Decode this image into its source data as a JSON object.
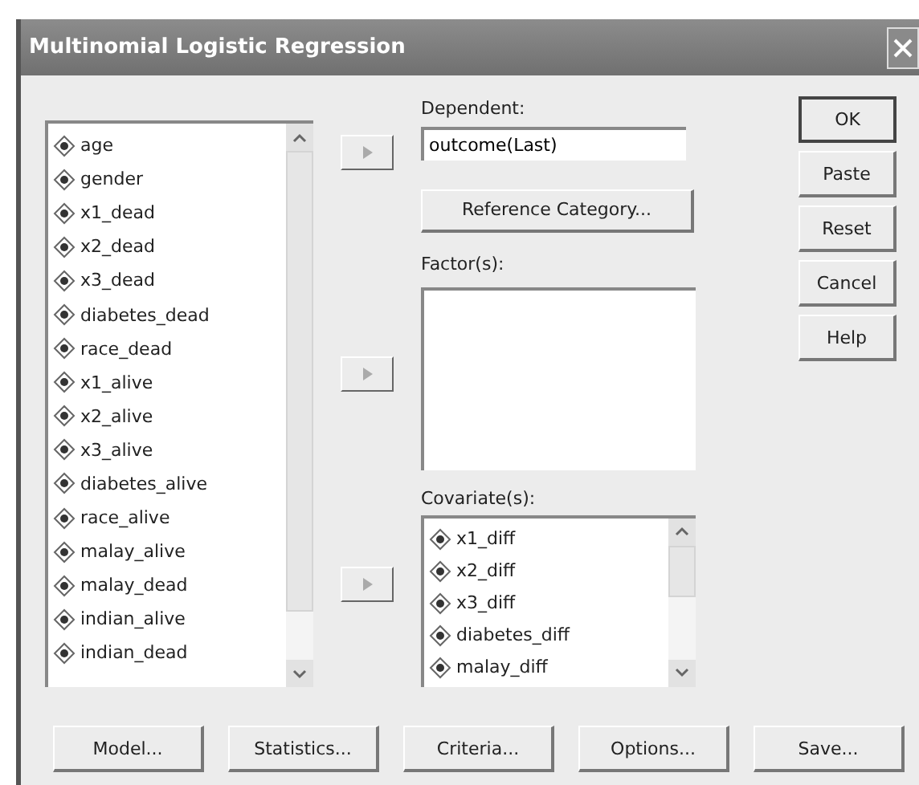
{
  "window": {
    "title": "Multinomial Logistic Regression"
  },
  "variables": [
    "age",
    "gender",
    "x1_dead",
    "x2_dead",
    "x3_dead",
    "diabetes_dead",
    "race_dead",
    "x1_alive",
    "x2_alive",
    "x3_alive",
    "diabetes_alive",
    "race_alive",
    "malay_alive",
    "malay_dead",
    "indian_alive",
    "indian_dead"
  ],
  "dependent": {
    "label": "Dependent:",
    "value": "outcome(Last)"
  },
  "reference_button": "Reference Category...",
  "factors": {
    "label": "Factor(s):"
  },
  "covariates": {
    "label": "Covariate(s):",
    "items": [
      "x1_diff",
      "x2_diff",
      "x3_diff",
      "diabetes_diff",
      "malay_diff"
    ]
  },
  "side_buttons": [
    {
      "label": "OK",
      "default": true
    },
    {
      "label": "Paste",
      "default": false
    },
    {
      "label": "Reset",
      "default": false
    },
    {
      "label": "Cancel",
      "default": false
    },
    {
      "label": "Help",
      "default": false
    }
  ],
  "bottom_buttons": [
    "Model...",
    "Statistics...",
    "Criteria...",
    "Options...",
    "Save..."
  ]
}
